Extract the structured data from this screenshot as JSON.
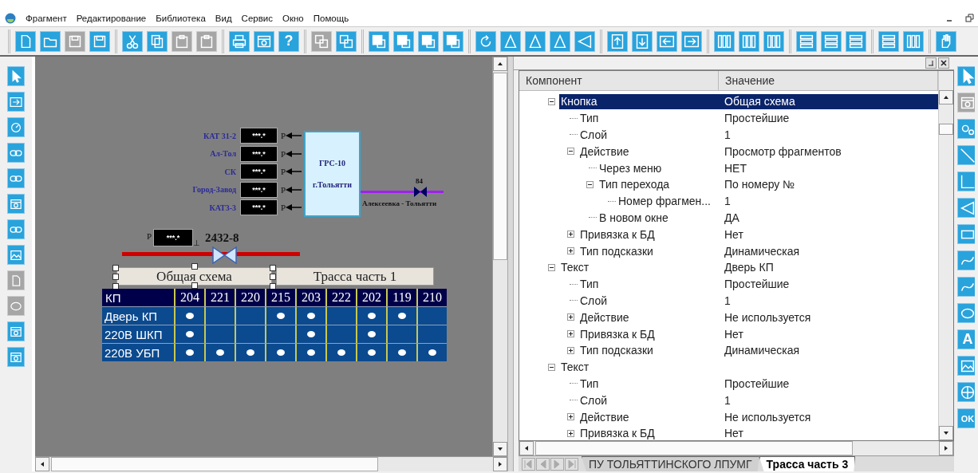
{
  "menu": [
    "Фрагмент",
    "Редактирование",
    "Библиотека",
    "Вид",
    "Сервис",
    "Окно",
    "Помощь"
  ],
  "toolbar": {
    "groups": [
      [
        {
          "disabled": false
        },
        {
          "disabled": false
        },
        {
          "disabled": true
        },
        {
          "disabled": false
        }
      ],
      [
        {
          "disabled": false
        },
        {
          "disabled": false
        },
        {
          "disabled": true
        },
        {
          "disabled": true
        }
      ],
      [
        {
          "disabled": false
        },
        {
          "disabled": false
        },
        {
          "disabled": false,
          "label": "?"
        }
      ],
      [
        {
          "disabled": true
        },
        {
          "disabled": false
        }
      ],
      [
        {
          "disabled": false
        },
        {
          "disabled": false
        },
        {
          "disabled": false
        },
        {
          "disabled": false
        }
      ],
      [
        {
          "disabled": false
        },
        {
          "disabled": false
        },
        {
          "disabled": false
        },
        {
          "disabled": false
        },
        {
          "disabled": false
        }
      ],
      [
        {
          "disabled": false
        },
        {
          "disabled": false
        },
        {
          "disabled": false
        },
        {
          "disabled": false
        }
      ],
      [
        {
          "disabled": false
        },
        {
          "disabled": false
        },
        {
          "disabled": false
        }
      ],
      [
        {
          "disabled": false
        },
        {
          "disabled": false
        },
        {
          "disabled": false
        }
      ],
      [
        {
          "disabled": false
        },
        {
          "disabled": false
        }
      ],
      [
        {
          "disabled": false
        }
      ]
    ]
  },
  "left_toolbar": [
    {
      "disabled": false
    },
    {
      "disabled": false
    },
    {
      "disabled": false
    },
    {
      "disabled": false
    },
    {
      "disabled": false
    },
    {
      "disabled": false
    },
    {
      "disabled": false
    },
    {
      "disabled": false
    },
    {
      "disabled": true
    },
    {
      "disabled": true
    },
    {
      "disabled": false
    },
    {
      "disabled": false
    }
  ],
  "right_toolbar": [
    {
      "disabled": false
    },
    {
      "disabled": true
    },
    {
      "disabled": false
    },
    {
      "disabled": false
    },
    {
      "disabled": false
    },
    {
      "disabled": false
    },
    {
      "disabled": false
    },
    {
      "disabled": false
    },
    {
      "disabled": false
    },
    {
      "disabled": false
    },
    {
      "disabled": false,
      "label": "A"
    },
    {
      "disabled": false
    },
    {
      "disabled": false
    },
    {
      "disabled": false,
      "label": "OK"
    }
  ],
  "canvas": {
    "meters": [
      {
        "label": "КАТ 31-2",
        "reading": "***.*",
        "unit": "P"
      },
      {
        "label": "Ал-Тол",
        "reading": "***.*",
        "unit": "P"
      },
      {
        "label": "СК",
        "reading": "***.*",
        "unit": "P"
      },
      {
        "label": "Город-Завод",
        "reading": "***.*",
        "unit": "P"
      },
      {
        "label": "КАТ3-3",
        "reading": "***.*",
        "unit": "P"
      }
    ],
    "station": {
      "title": "ГРС-10",
      "city": "г.Тольятти"
    },
    "pipeline": {
      "valve": "84",
      "label": "Алексеевка - Тольятти"
    },
    "pressure": {
      "unit": "P",
      "reading": "***.*",
      "mark": "⊥",
      "valve": "2432-8"
    },
    "buttons": [
      {
        "label": "Общая схема",
        "selected": true
      },
      {
        "label": "Трасса часть 1",
        "selected": false
      }
    ],
    "table": {
      "columns": [
        "КП",
        "204",
        "221",
        "220",
        "215",
        "203",
        "222",
        "202",
        "119",
        "210"
      ],
      "rows": [
        {
          "label": "Дверь КП",
          "cells": [
            true,
            false,
            false,
            true,
            true,
            false,
            true,
            true,
            false
          ]
        },
        {
          "label": "220В ШКП",
          "cells": [
            true,
            false,
            false,
            false,
            true,
            false,
            true,
            false,
            false
          ]
        },
        {
          "label": "220В УБП",
          "cells": [
            true,
            true,
            true,
            true,
            true,
            true,
            true,
            true,
            true
          ]
        }
      ]
    }
  },
  "properties": {
    "columns": [
      "Компонент",
      "Значение"
    ],
    "tree": [
      {
        "name": "Кнопка",
        "value": "Общая схема",
        "expanded": true,
        "selected": true,
        "children": [
          {
            "name": "Тип",
            "value": "Простейшие",
            "selected": false
          },
          {
            "name": "Слой",
            "value": "1",
            "selected": false
          },
          {
            "name": "Действие",
            "value": "Просмотр фрагментов",
            "expanded": true,
            "selected": false,
            "children": [
              {
                "name": "Через меню",
                "value": "НЕТ",
                "selected": false
              },
              {
                "name": "Тип перехода",
                "value": "По номеру №",
                "expanded": true,
                "selected": false,
                "children": [
                  {
                    "name": "Номер фрагмен...",
                    "value": "1",
                    "selected": false
                  }
                ]
              },
              {
                "name": "В новом окне",
                "value": "ДА",
                "selected": false
              }
            ]
          },
          {
            "name": "Привязка к БД",
            "value": "Нет",
            "expanded": false,
            "selected": false
          },
          {
            "name": "Тип подсказки",
            "value": "Динамическая",
            "expanded": false,
            "selected": false
          }
        ]
      },
      {
        "name": "Текст",
        "value": "Дверь КП",
        "expanded": true,
        "selected": false,
        "children": [
          {
            "name": "Тип",
            "value": "Простейшие",
            "selected": false
          },
          {
            "name": "Слой",
            "value": "1",
            "selected": false
          },
          {
            "name": "Действие",
            "value": "Не используется",
            "expanded": false,
            "selected": false
          },
          {
            "name": "Привязка к БД",
            "value": "Нет",
            "expanded": false,
            "selected": false
          },
          {
            "name": "Тип подсказки",
            "value": "Динамическая",
            "expanded": false,
            "selected": false
          }
        ]
      },
      {
        "name": "Текст",
        "expanded": true,
        "selected": false,
        "children": [
          {
            "name": "Тип",
            "value": "Простейшие",
            "selected": false
          },
          {
            "name": "Слой",
            "value": "1",
            "selected": false
          },
          {
            "name": "Действие",
            "value": "Не используется",
            "expanded": false,
            "selected": false
          },
          {
            "name": "Привязка к БД",
            "value": "Нет",
            "expanded": false,
            "selected": false
          }
        ]
      }
    ]
  },
  "sheet_tabs": [
    {
      "label": "ПУ ТОЛЬЯТТИНСКОГО ЛПУМГ",
      "selected": false
    },
    {
      "label": "Трасса часть 3",
      "selected": true
    }
  ]
}
